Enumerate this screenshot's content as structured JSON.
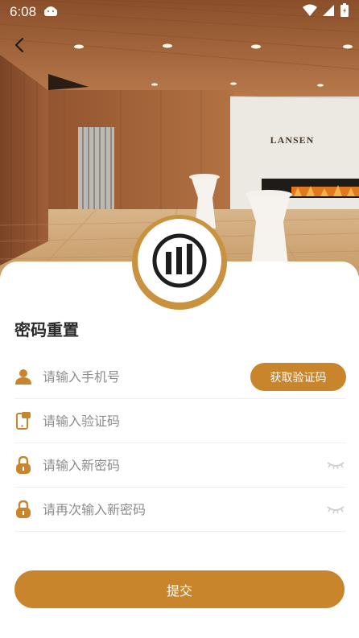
{
  "status_bar": {
    "time": "6:08"
  },
  "hero": {
    "brand_text": "LANSEN"
  },
  "page": {
    "title": "密码重置"
  },
  "form": {
    "phone_placeholder": "请输入手机号",
    "get_code_label": "获取验证码",
    "code_placeholder": "请输入验证码",
    "new_password_placeholder": "请输入新密码",
    "confirm_password_placeholder": "请再次输入新密码",
    "submit_label": "提交"
  },
  "colors": {
    "accent": "#c8852c",
    "logo_ring": "#c8923f",
    "icon": "#c8852c",
    "placeholder": "#8c8c8c",
    "eye_icon": "#cfcfcf"
  },
  "icons": {
    "back": "chevron-left-icon",
    "phone_field": "user-icon",
    "code_field": "phone-message-icon",
    "password_field": "lock-icon",
    "password_toggle": "eye-closed-icon"
  }
}
